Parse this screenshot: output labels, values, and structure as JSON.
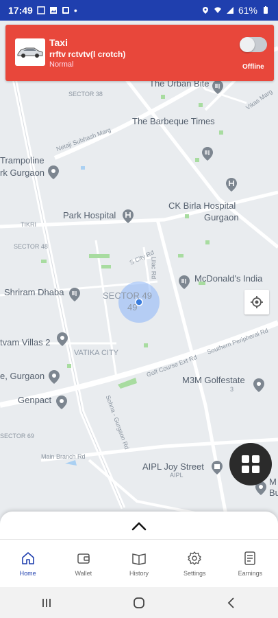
{
  "status_bar": {
    "time": "17:49",
    "battery": "61%"
  },
  "header_card": {
    "title": "Taxi",
    "driver_name": "rrftv rctvtv(l crotch)",
    "subtitle": "Normal",
    "status": "Offline",
    "online": false,
    "accent_color": "#e8473b"
  },
  "map": {
    "labels": {
      "sector38": "SECTOR 38",
      "urban_bite": "The Urban Bite",
      "barbeque": "The Barbeque Times",
      "vikas_marg": "Vikas Marg",
      "netaji": "Netaji Subhash Marg",
      "trampoline": "Trampoline",
      "park_gurgaon": "rk Gurgaon",
      "park_hospital": "Park Hospital",
      "ckbirla": "CK Birla Hospital",
      "gurgaon": "Gurgaon",
      "tikri": "TIKRI",
      "sector48": "SECTOR 48",
      "s_city_rd": "S City Rd",
      "lilac_rd": "Lilac Rd",
      "mcdonalds": "McDonald's India",
      "shriram": "Shriram Dhaba",
      "sector49": "SECTOR 49",
      "sector49b": "49",
      "tvam": "tvam Villas 2",
      "vatika": "VATIKA CITY",
      "golf_course": "Golf Course Ext Rd",
      "southern": "Southern Peripheral Rd",
      "e_gurgaon": "e, Gurgaon",
      "m3m": "M3M Golfestate",
      "genpact": "Genpact",
      "sector69": "SECTOR 69",
      "sohna": "Sohna - Gurgaon Rd",
      "main_branch": "Main Branch Rd",
      "aipl": "AIPL Joy Street",
      "aipl_small": "AIPL",
      "m_bu": "M",
      "bu": "Bu",
      "three": "3"
    }
  },
  "bottom_nav": {
    "tabs": [
      {
        "label": "Home",
        "icon": "home-icon",
        "active": true
      },
      {
        "label": "Wallet",
        "icon": "wallet-icon",
        "active": false
      },
      {
        "label": "History",
        "icon": "history-icon",
        "active": false
      },
      {
        "label": "Settings",
        "icon": "settings-icon",
        "active": false
      },
      {
        "label": "Earnings",
        "icon": "earnings-icon",
        "active": false
      }
    ]
  }
}
